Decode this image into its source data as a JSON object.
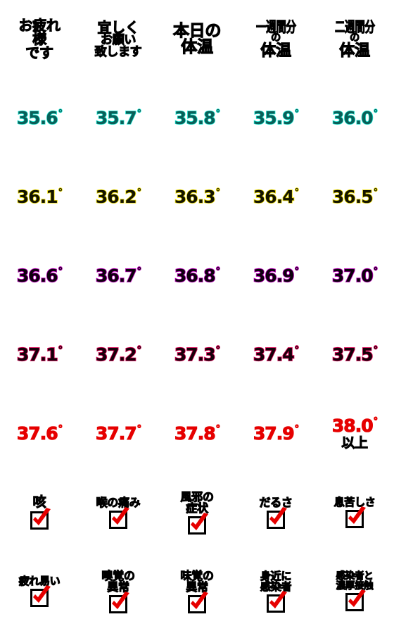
{
  "page": {
    "title": "体温・体調 絵文字一覧",
    "columns": 5,
    "rows": 8,
    "background_color": "#ffffff"
  },
  "colors": {
    "heading_text": "#000000",
    "row2_fill": "#0a5f58",
    "row2_stroke": "#18e6d2",
    "row3_fill": "#141400",
    "row3_stroke": "#f2e10a",
    "row4_fill": "#0d000d",
    "row4_stroke": "#b500b5",
    "row5_fill": "#16000a",
    "row5_stroke": "#d1004f",
    "row6_fill": "#e60000",
    "checkbox_border": "#000000",
    "check_mark": "#e60000"
  },
  "headings": [
    {
      "lines": [
        "お疲れ",
        "様",
        "です"
      ],
      "text": "お疲れ様です"
    },
    {
      "lines": [
        "宜しく",
        "お願い",
        "致します"
      ],
      "text": "宜しくお願い致します"
    },
    {
      "lines": [
        "本日の",
        "体温"
      ],
      "text": "本日の体温"
    },
    {
      "lines": [
        "一週間分",
        "の",
        "体温"
      ],
      "text": "一週間分の体温"
    },
    {
      "lines": [
        "二週間分",
        "の",
        "体温"
      ],
      "text": "二週間分の体温"
    }
  ],
  "temperatures": [
    {
      "color_name": "teal",
      "values": [
        {
          "number": "35.6",
          "degree": "°"
        },
        {
          "number": "35.7",
          "degree": "°"
        },
        {
          "number": "35.8",
          "degree": "°"
        },
        {
          "number": "35.9",
          "degree": "°"
        },
        {
          "number": "36.0",
          "degree": "°"
        }
      ]
    },
    {
      "color_name": "yellow",
      "values": [
        {
          "number": "36.1",
          "degree": "°"
        },
        {
          "number": "36.2",
          "degree": "°"
        },
        {
          "number": "36.3",
          "degree": "°"
        },
        {
          "number": "36.4",
          "degree": "°"
        },
        {
          "number": "36.5",
          "degree": "°"
        }
      ]
    },
    {
      "color_name": "purple",
      "values": [
        {
          "number": "36.6",
          "degree": "°"
        },
        {
          "number": "36.7",
          "degree": "°"
        },
        {
          "number": "36.8",
          "degree": "°"
        },
        {
          "number": "36.9",
          "degree": "°"
        },
        {
          "number": "37.0",
          "degree": "°"
        }
      ]
    },
    {
      "color_name": "crimson",
      "values": [
        {
          "number": "37.1",
          "degree": "°"
        },
        {
          "number": "37.2",
          "degree": "°"
        },
        {
          "number": "37.3",
          "degree": "°"
        },
        {
          "number": "37.4",
          "degree": "°"
        },
        {
          "number": "37.5",
          "degree": "°"
        }
      ]
    },
    {
      "color_name": "red",
      "values": [
        {
          "number": "37.6",
          "degree": "°",
          "suffix": ""
        },
        {
          "number": "37.7",
          "degree": "°",
          "suffix": ""
        },
        {
          "number": "37.8",
          "degree": "°",
          "suffix": ""
        },
        {
          "number": "37.9",
          "degree": "°",
          "suffix": ""
        },
        {
          "number": "38.0",
          "degree": "°",
          "suffix": "以上"
        }
      ]
    }
  ],
  "symptoms": [
    {
      "row": 1,
      "items": [
        {
          "lines": [
            "咳"
          ],
          "text": "咳",
          "checked": true,
          "icon": "checked-checkbox-icon"
        },
        {
          "lines": [
            "喉の痛み"
          ],
          "text": "喉の痛み",
          "checked": true,
          "icon": "checked-checkbox-icon"
        },
        {
          "lines": [
            "風邪の",
            "症状"
          ],
          "text": "風邪の症状",
          "checked": true,
          "icon": "checked-checkbox-icon"
        },
        {
          "lines": [
            "だるさ"
          ],
          "text": "だるさ",
          "checked": true,
          "icon": "checked-checkbox-icon"
        },
        {
          "lines": [
            "息苦しさ"
          ],
          "text": "息苦しさ",
          "checked": true,
          "icon": "checked-checkbox-icon"
        }
      ]
    },
    {
      "row": 2,
      "items": [
        {
          "lines": [
            "疲れ易い"
          ],
          "text": "疲れ易い",
          "checked": true,
          "icon": "checked-checkbox-icon"
        },
        {
          "lines": [
            "嗅覚の",
            "異常"
          ],
          "text": "嗅覚の異常",
          "checked": true,
          "icon": "checked-checkbox-icon"
        },
        {
          "lines": [
            "味覚の",
            "異常"
          ],
          "text": "味覚の異常",
          "checked": true,
          "icon": "checked-checkbox-icon"
        },
        {
          "lines": [
            "身近に",
            "感染者"
          ],
          "text": "身近に感染者",
          "checked": true,
          "icon": "checked-checkbox-icon"
        },
        {
          "lines": [
            "感染者と",
            "濃厚接触"
          ],
          "text": "感染者と濃厚接触",
          "checked": true,
          "icon": "checked-checkbox-icon"
        }
      ]
    }
  ]
}
